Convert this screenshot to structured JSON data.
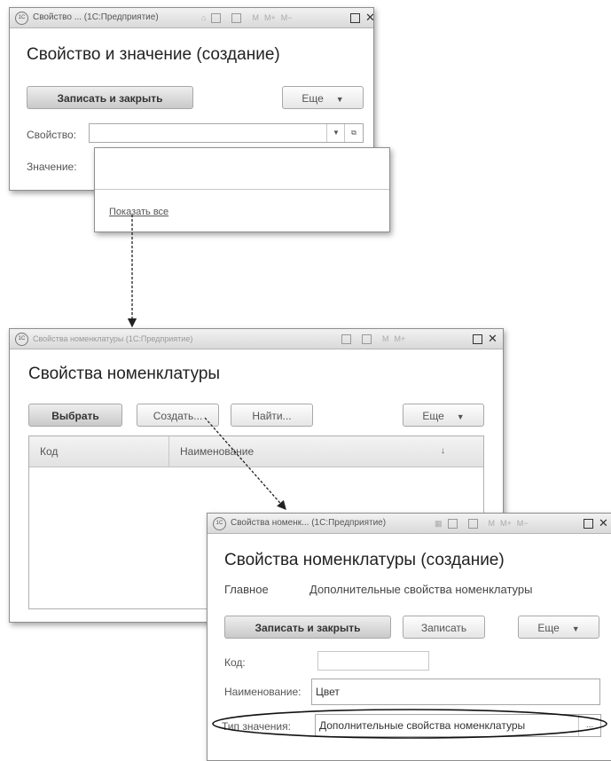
{
  "w1": {
    "title": "Свойство ... (1С:Предприятие)",
    "heading": "Свойство и значение (создание)",
    "save_close": "Записать и закрыть",
    "more": "Еще",
    "prop_label": "Свойство:",
    "value_label": "Значение:",
    "show_all": "Показать все"
  },
  "w2": {
    "title": "Свойства номенклатуры (1С:Предприятие)",
    "heading": "Свойства номенклатуры",
    "select": "Выбрать",
    "create": "Создать...",
    "find": "Найти...",
    "more": "Еще",
    "col_code": "Код",
    "col_name": "Наименование"
  },
  "w3": {
    "title": "Свойства номенк... (1С:Предприятие)",
    "heading": "Свойства номенклатуры (создание)",
    "tab_main": "Главное",
    "tab_additional": "Дополнительные свойства номенклатуры",
    "save_close": "Записать и закрыть",
    "save": "Записать",
    "more": "Еще",
    "code_label": "Код:",
    "name_label": "Наименование:",
    "name_value": "Цвет",
    "type_label": "Тип значения:",
    "type_value": "Дополнительные свойства номенклатуры"
  }
}
